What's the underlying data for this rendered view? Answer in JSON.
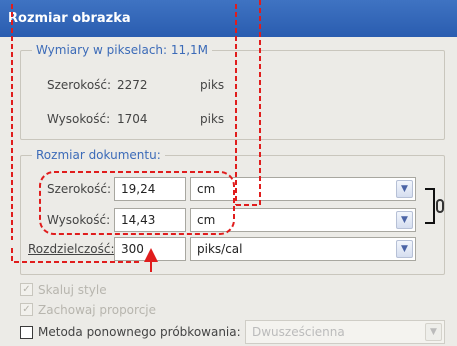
{
  "window": {
    "title": "Rozmiar obrazka"
  },
  "pixel_dimensions": {
    "legend": "Wymiary w pikselach:",
    "size_value": "11,1M",
    "width_label": "Szerokość:",
    "width_value": "2272",
    "width_unit": "piks",
    "height_label": "Wysokość:",
    "height_value": "1704",
    "height_unit": "piks"
  },
  "document_size": {
    "legend": "Rozmiar dokumentu:",
    "width_label": "Szerokość:",
    "width_value": "19,24",
    "width_unit": "cm",
    "height_label": "Wysokość:",
    "height_value": "14,43",
    "height_unit": "cm",
    "resolution_label": "Rozdzielczość:",
    "resolution_value": "300",
    "resolution_unit": "piks/cal"
  },
  "options": {
    "scale_styles": "Skaluj style",
    "constrain_proportions": "Zachowaj proporcje",
    "resample_label": "Metoda ponownego próbkowania:",
    "resample_value": "Dwusześcienna"
  },
  "colors": {
    "title_bar": "#2f62b6",
    "legend_text": "#3c6bb8",
    "annotation": "#e01d1d"
  },
  "icons": {
    "dropdown": "chevron-down-icon",
    "link": "chain-link-icon",
    "pointer": "arrow-up-icon"
  }
}
